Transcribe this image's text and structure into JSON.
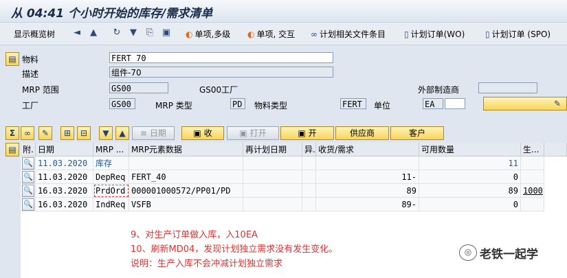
{
  "title": "从 04:41 个小时开始的库存/需求清单",
  "toolbar": {
    "overview": "显示概览树",
    "single_multi": "单项,多级",
    "single_inter": "单项, 交互",
    "plan_files": "计划相关文件条目",
    "plan_order_wo": "计划订单(WO)",
    "plan_order_spo": "计划订单 (SPO)"
  },
  "header": {
    "material_label": "物料",
    "material_value": "FERT_70",
    "desc_label": "描述",
    "desc_value": "组件-70",
    "mrp_area_label": "MRP 范围",
    "mrp_area_value": "GS00",
    "mrp_area_text": "GS00工厂",
    "ext_label": "外部制造商",
    "plant_label": "工厂",
    "plant_value": "GS00",
    "mrp_type_label": "MRP 类型",
    "mrp_type_value": "PD",
    "mat_type_label": "物料类型",
    "mat_type_value": "FERT",
    "unit_label": "单位",
    "unit_value": "EA"
  },
  "buttons": {
    "date": "日期",
    "receipt": "收",
    "open": "打开",
    "open2": "开",
    "vendor": "供应商",
    "customer": "客户"
  },
  "table": {
    "columns": [
      "附.",
      "日期",
      "MRP ...",
      "MRP元素数据",
      "再计划日期",
      "异.",
      "收货/需求",
      "可用数量",
      "生..."
    ],
    "rows": [
      {
        "date": "11.03.2020",
        "mrp": "库存",
        "data": "",
        "reschedule": "",
        "exc": "",
        "qty": "",
        "avail": "11",
        "prod": ""
      },
      {
        "date": "11.03.2020",
        "mrp": "DepReq",
        "data": "FERT_40",
        "reschedule": "",
        "exc": "",
        "qty": "11-",
        "avail": "0",
        "prod": ""
      },
      {
        "date": "16.03.2020",
        "mrp": "PrdOrd",
        "data": "000001000572/PP01/PD",
        "reschedule": "",
        "exc": "",
        "qty": "89",
        "avail": "89",
        "prod": "1000"
      },
      {
        "date": "16.03.2020",
        "mrp": "IndReq",
        "data": "VSFB",
        "reschedule": "",
        "exc": "",
        "qty": "89-",
        "avail": "0",
        "prod": ""
      }
    ]
  },
  "notes": [
    "9、对生产订单做入库，入10EA",
    "10、刷新MD04，发现计划独立需求没有发生变化。",
    "说明：生产入库不会冲减计划独立需求"
  ],
  "watermark": "老铁一起学",
  "colors": {
    "accent": "#f7d55c",
    "note": "#e53030",
    "link_blue": "#1a5fa8"
  }
}
